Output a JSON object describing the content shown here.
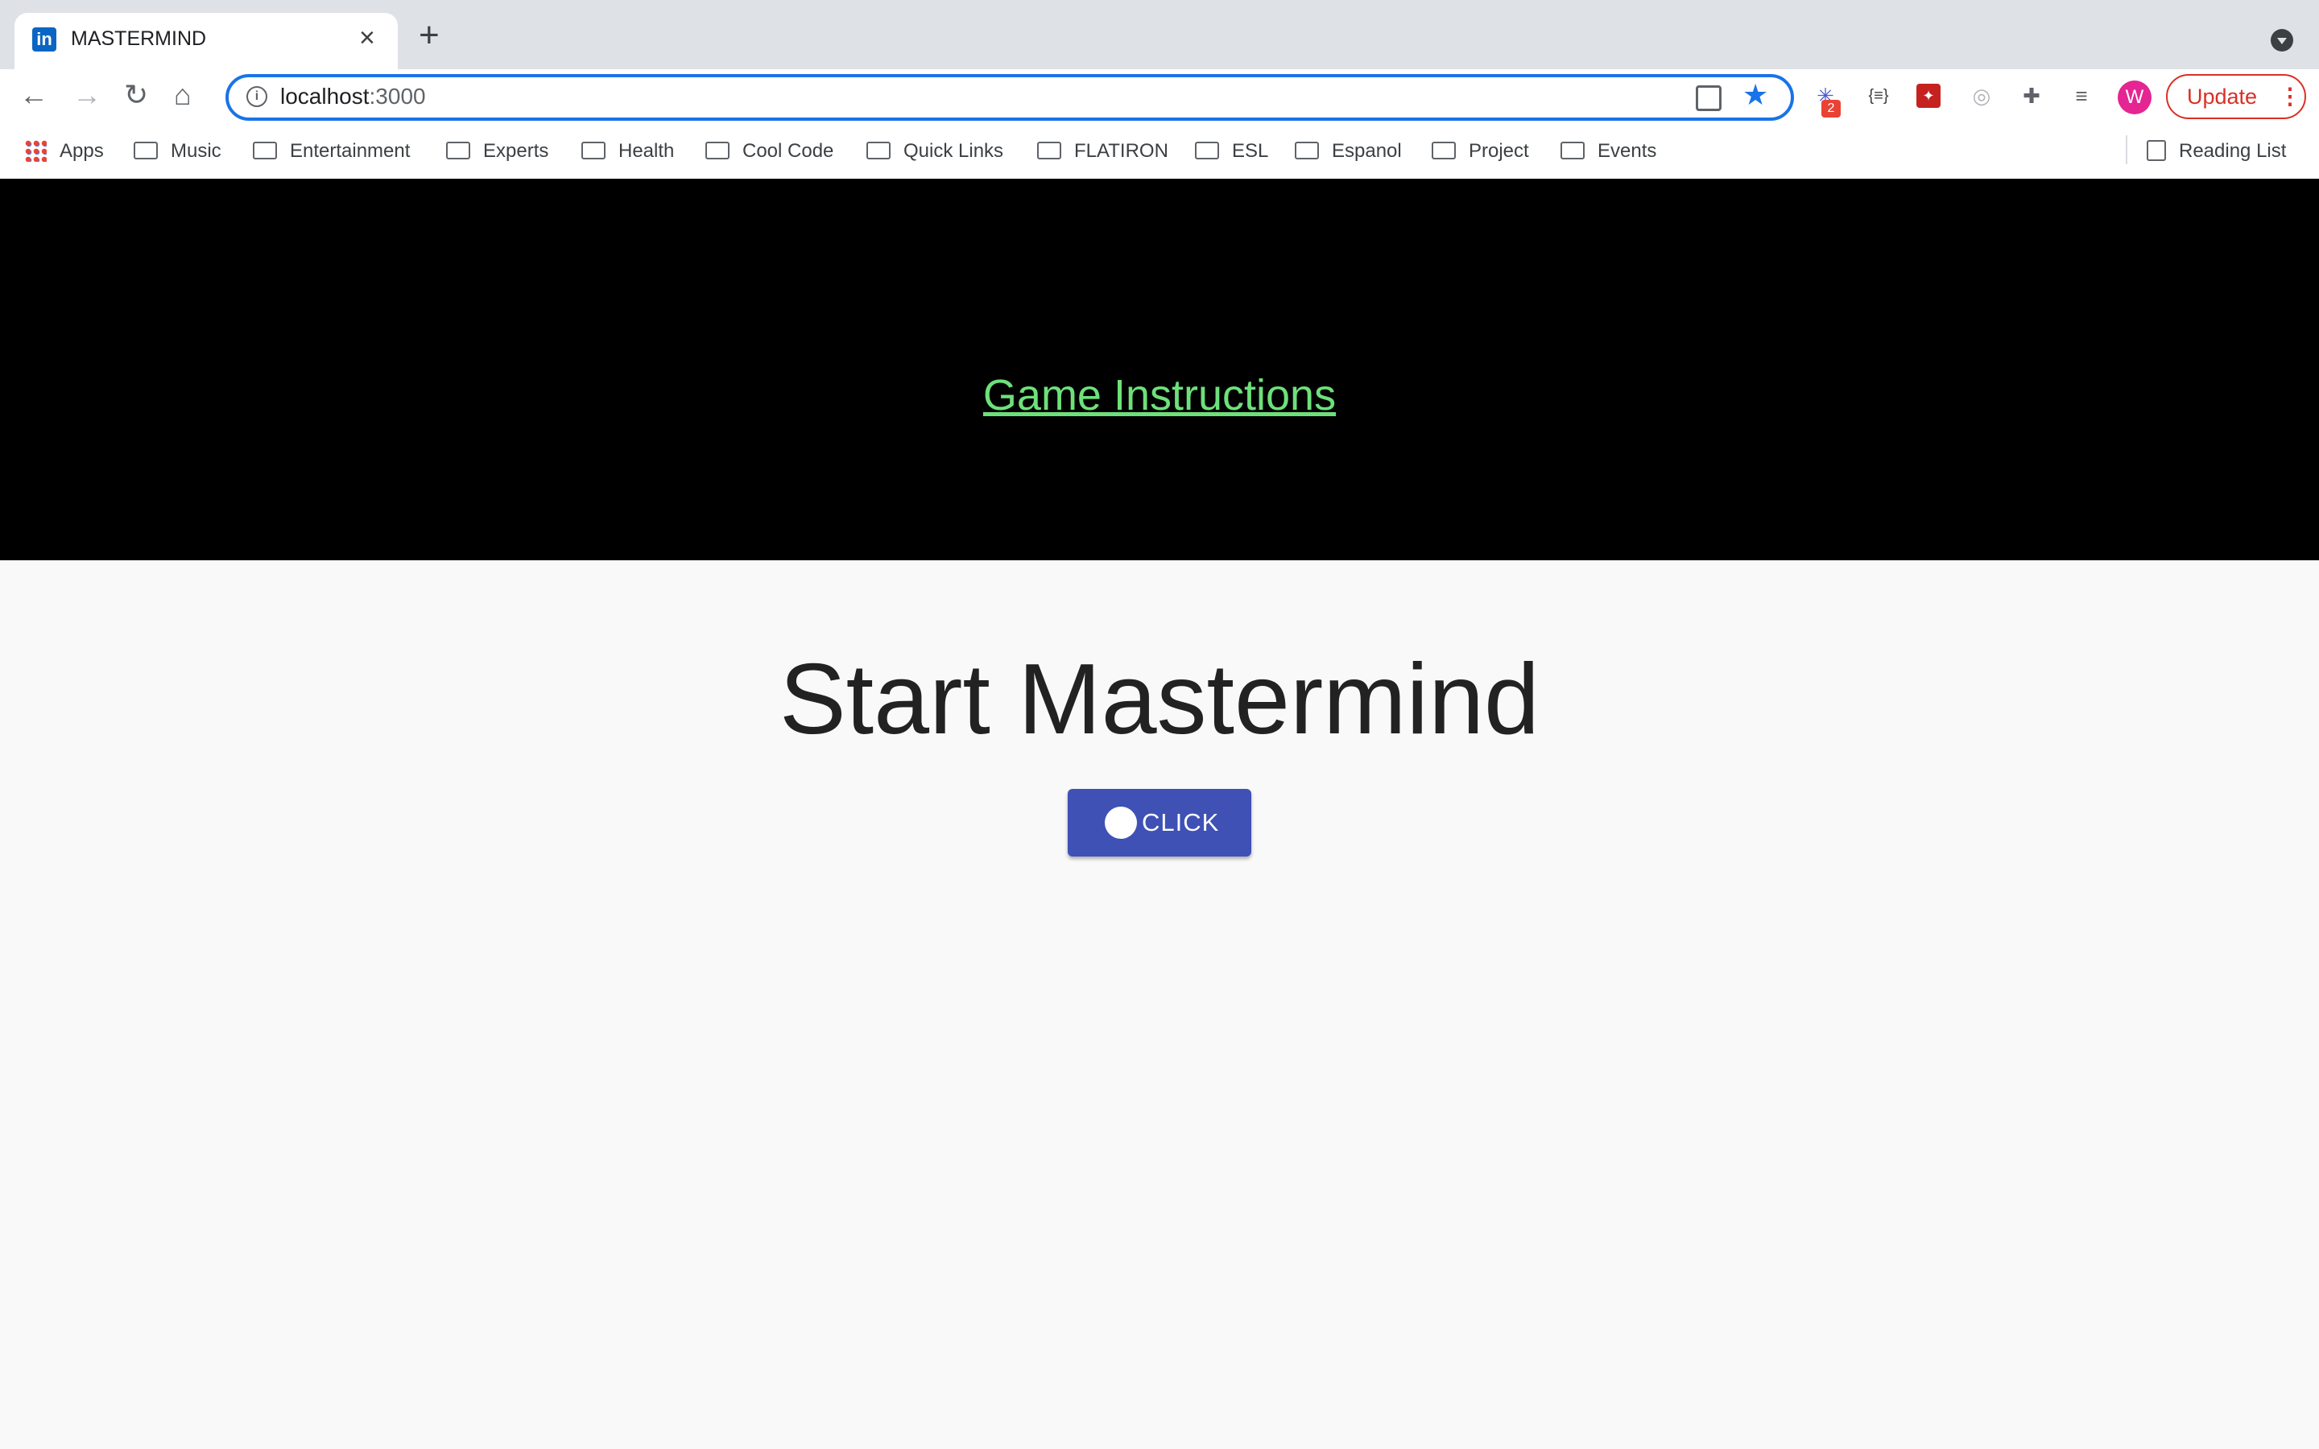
{
  "browser": {
    "tab": {
      "title": "MASTERMIND",
      "favicon": "in"
    },
    "url": {
      "host": "localhost",
      "port": ":3000"
    },
    "extensions": {
      "badge_count": "2",
      "json_icon": "{≡}"
    },
    "profile_initial": "W",
    "update_label": "Update"
  },
  "bookmarks": {
    "apps_label": "Apps",
    "items": [
      "Music",
      "Entertainment",
      "Experts",
      "Health",
      "Cool Code",
      "Quick Links",
      "FLATIRON",
      "ESL",
      "Espanol",
      "Project",
      "Events"
    ],
    "reading_list": "Reading List"
  },
  "page": {
    "instructions_link": "Game Instructions",
    "title": "Start Mastermind",
    "button_label": "CLICK",
    "colors": {
      "header_bg": "#000000",
      "link": "#6ee07a",
      "button": "#3f51b5"
    }
  }
}
